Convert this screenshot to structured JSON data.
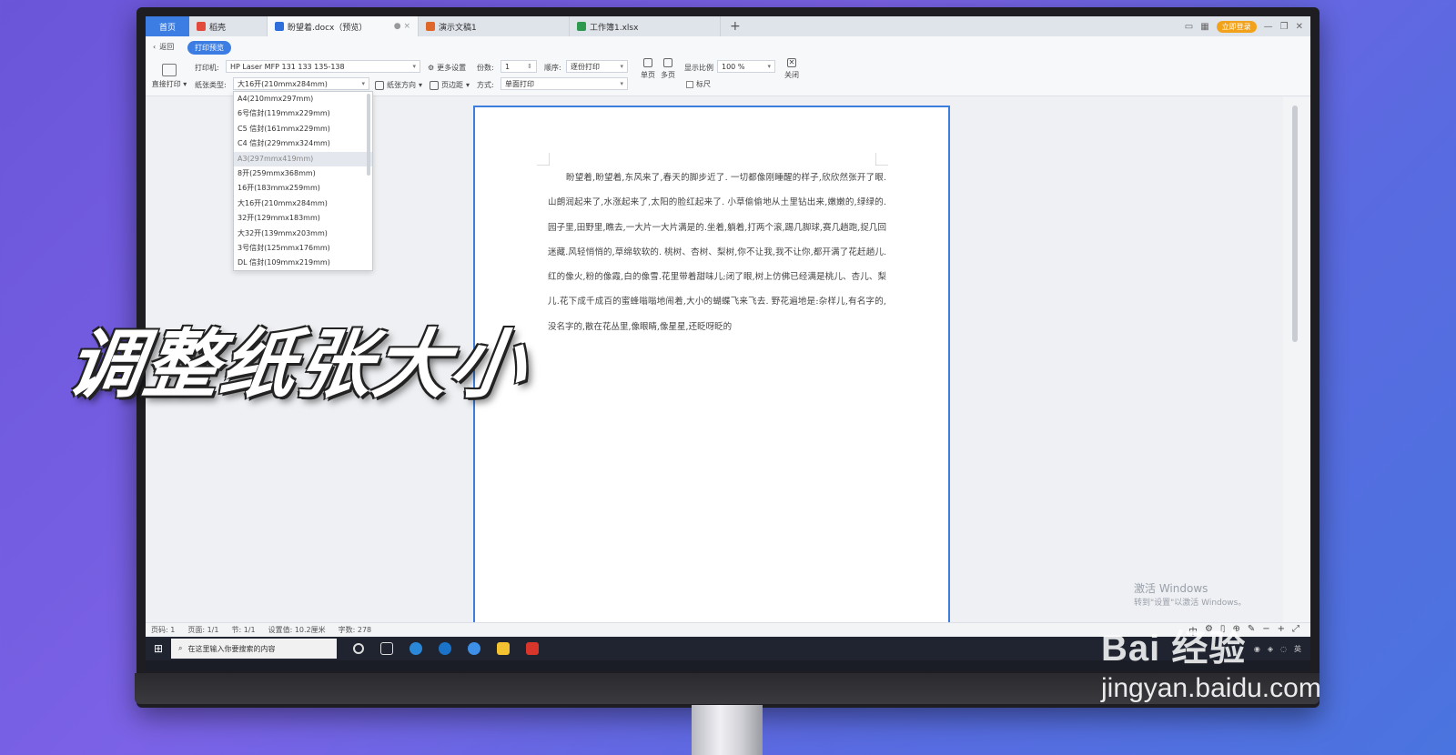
{
  "tabs": {
    "home": "首页",
    "items": [
      {
        "label": "稻壳",
        "color": "#e24a3b"
      },
      {
        "label": "盼望着.docx（预览）",
        "color": "#2f6fdb",
        "active": true
      },
      {
        "label": "演示文稿1",
        "color": "#e0672a"
      },
      {
        "label": "工作簿1.xlsx",
        "color": "#2e9a4f"
      }
    ],
    "add": "+",
    "login": "立即登录"
  },
  "toolbar": {
    "back": "返回",
    "mode": "打印预览",
    "direct_print": "直接打印",
    "printer_label": "打印机:",
    "printer_value": "HP Laser MFP 131 133 135-138",
    "more_settings": "更多设置",
    "copies_label": "份数:",
    "copies_value": "1",
    "order_label": "顺序:",
    "order_value": "逐份打印",
    "single_page": "单页",
    "multi_page": "多页",
    "zoom_label": "显示比例",
    "zoom_value": "100 %",
    "ruler": "标尺",
    "close": "关闭",
    "paper_type_label": "纸张类型:",
    "paper_type_value": "大16开(210mmx284mm)",
    "orientation": "纸张方向",
    "margins": "页边距",
    "method_label": "方式:",
    "method_value": "单面打印"
  },
  "paper_sizes": [
    "A4(210mmx297mm)",
    "6号信封(119mmx229mm)",
    "C5 信封(161mmx229mm)",
    "C4 信封(229mmx324mm)",
    "A3(297mmx419mm)",
    "8开(259mmx368mm)",
    "16开(183mmx259mm)",
    "大16开(210mmx284mm)",
    "32开(129mmx183mm)",
    "大32开(139mmx203mm)",
    "3号信封(125mmx176mm)",
    "DL 信封(109mmx219mm)"
  ],
  "document": {
    "text": "盼望着,盼望着,东风来了,春天的脚步近了. 一切都像刚睡醒的样子,欣欣然张开了眼.山朗润起来了,水涨起来了,太阳的脸红起来了. 小草偷偷地从土里钻出来,嫩嫩的,绿绿的.园子里,田野里,瞧去,一大片一大片满是的.坐着,躺着,打两个滚,踢几脚球,赛几趟跑,捉几回迷藏.风轻悄悄的,草绵软软的. 桃树、杏树、梨树,你不让我,我不让你,都开满了花赶趟儿.红的像火,粉的像霞,白的像雪.花里带着甜味儿;闭了眼,树上仿佛已经满是桃儿、杏儿、梨儿.花下成千成百的蜜蜂嗡嗡地闹着,大小的蝴蝶飞来飞去. 野花遍地是:杂样儿,有名字的,没名字的,散在花丛里,像眼睛,像星星,还眨呀眨的"
  },
  "statusbar": {
    "page_no": "页码: 1",
    "pages": "页面: 1/1",
    "section": "节: 1/1",
    "setting": "设置值: 10.2厘米",
    "words": "字数: 278",
    "ime": "中"
  },
  "taskbar": {
    "search_placeholder": "在这里输入你要搜索的内容",
    "lang": "英"
  },
  "activation": {
    "title": "激活 Windows",
    "sub": "转到\"设置\"以激活 Windows。"
  },
  "caption": "调整纸张大小",
  "watermark": {
    "brand": "Bai 经验",
    "site": "jingyan.baidu.com"
  }
}
